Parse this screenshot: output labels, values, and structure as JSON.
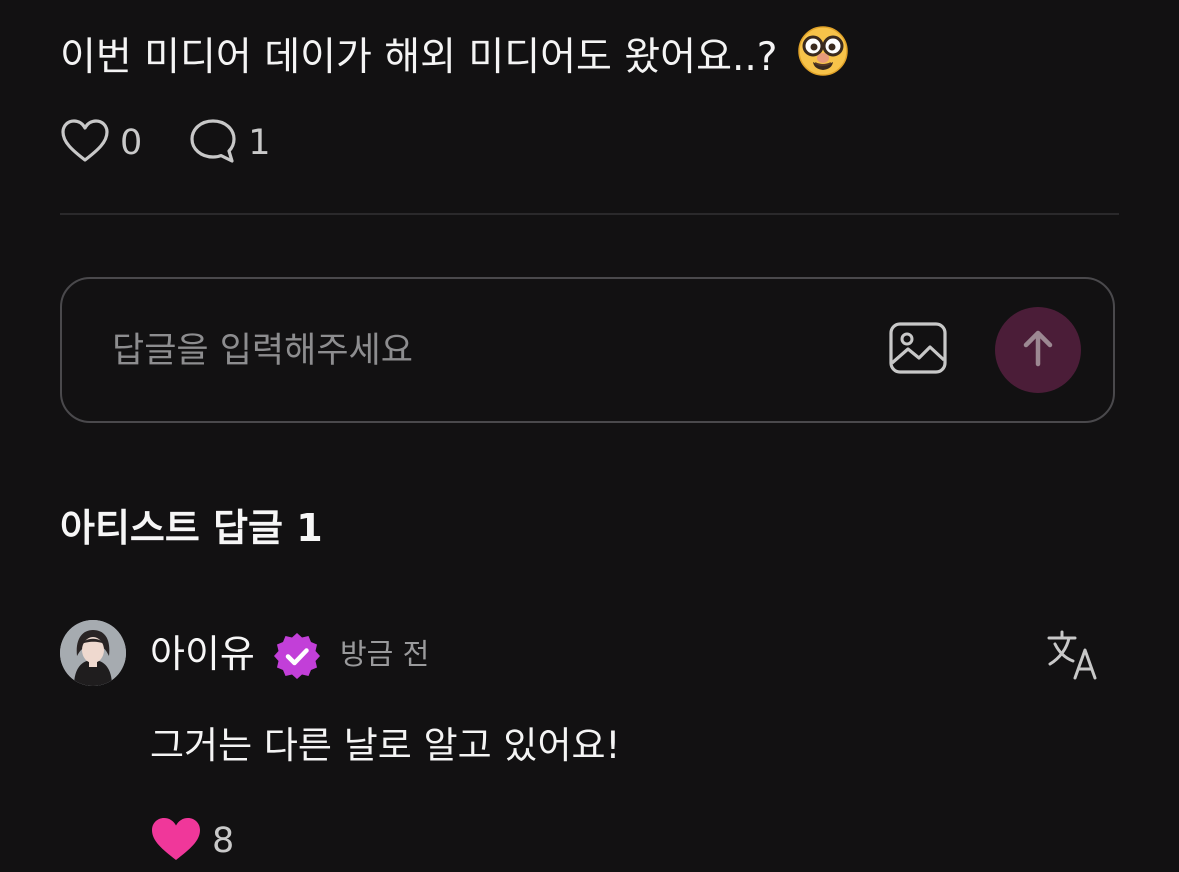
{
  "post": {
    "text": "이번 미디어 데이가 해외 미디어도 왔어요..?",
    "emoji": "nerd-glasses-face",
    "like_count": "0",
    "comment_count": "1"
  },
  "reply": {
    "placeholder": "답글을 입력해주세요"
  },
  "artist_replies": {
    "title": "아티스트 답글 1"
  },
  "comment": {
    "author": "아이유",
    "time": "방금 전",
    "text": "그거는 다른 날로 알고 있어요!",
    "like_count": "8"
  },
  "colors": {
    "background": "#121112",
    "send_button": "#4b1d38",
    "verified": "#c23fd8",
    "like_active": "#f0379a"
  },
  "icons": {
    "like": "heart-outline-icon",
    "comment": "speech-bubble-icon",
    "image": "image-icon",
    "send": "arrow-up-icon",
    "verified": "verified-badge-icon",
    "translate": "translate-icon",
    "comment_like": "heart-filled-icon"
  }
}
